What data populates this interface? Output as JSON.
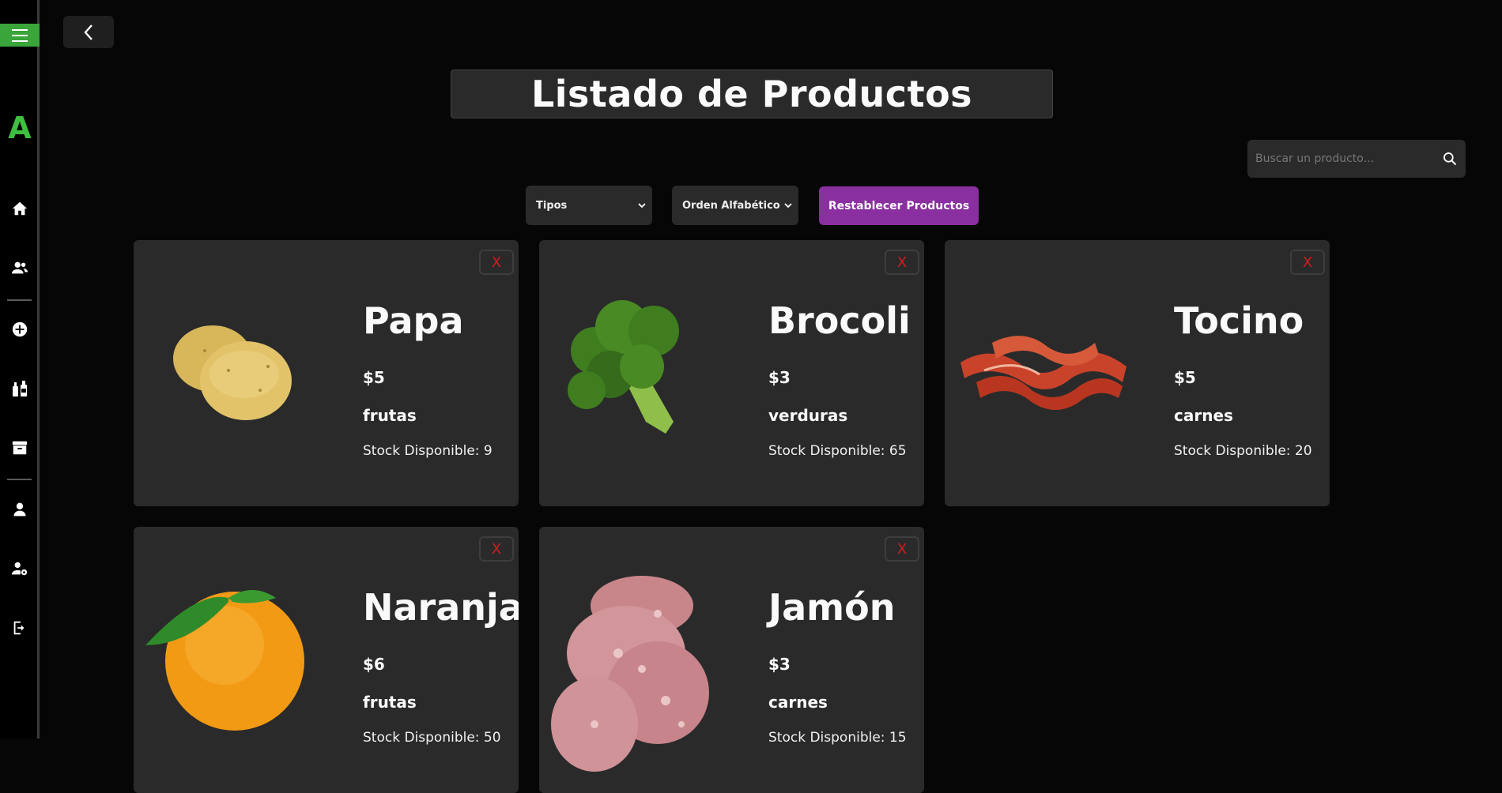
{
  "sidebar": {
    "logo": "A",
    "icons": [
      "home-icon",
      "users-icon",
      "add-circle-icon",
      "bottles-icon",
      "archive-icon",
      "user-icon",
      "user-settings-icon",
      "logout-icon"
    ]
  },
  "header": {
    "title": "Listado de Productos"
  },
  "search": {
    "placeholder": "Buscar un producto..."
  },
  "filters": {
    "type_select": "Tipos",
    "order_select": "Orden Alfabético",
    "reset_label": "Restablecer Productos"
  },
  "colors": {
    "accent_green": "#3aa53a",
    "accent_purple": "#8a2fa0",
    "delete_red": "#d11d1d",
    "card_bg": "#2a2a2b"
  },
  "products": [
    {
      "close": "X",
      "name": "Papa",
      "price": "$5",
      "category": "frutas",
      "stock": "Stock Disponible: 9",
      "image": "potato"
    },
    {
      "close": "X",
      "name": "Brocoli",
      "price": "$3",
      "category": "verduras",
      "stock": "Stock Disponible: 65",
      "image": "broccoli"
    },
    {
      "close": "X",
      "name": "Tocino",
      "price": "$5",
      "category": "carnes",
      "stock": "Stock Disponible: 20",
      "image": "bacon"
    },
    {
      "close": "X",
      "name": "Naranja",
      "price": "$6",
      "category": "frutas",
      "stock": "Stock Disponible: 50",
      "image": "orange"
    },
    {
      "close": "X",
      "name": "Jamón",
      "price": "$3",
      "category": "carnes",
      "stock": "Stock Disponible: 15",
      "image": "ham"
    }
  ]
}
